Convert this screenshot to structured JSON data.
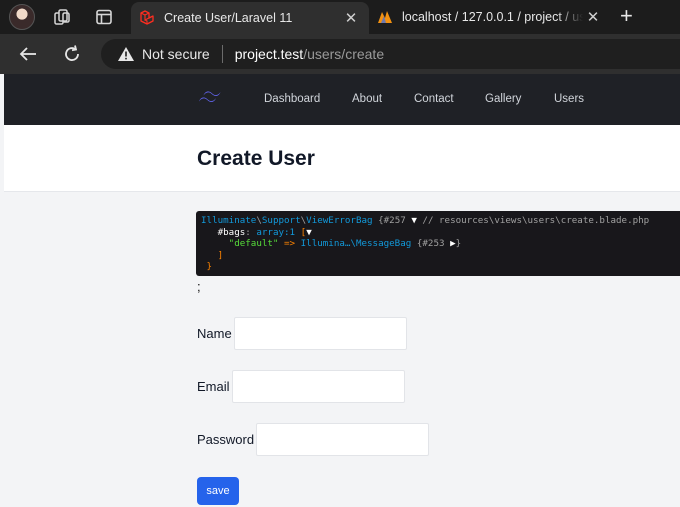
{
  "browser": {
    "tabs": [
      {
        "title": "Create User/Laravel 11",
        "active": true,
        "favicon": "laravel-icon"
      },
      {
        "title": "localhost / 127.0.0.1 / project / use",
        "active": false,
        "favicon": "phpmyadmin-icon"
      }
    ],
    "security_label": "Not secure",
    "url_host": "project.test",
    "url_path": "/users/create",
    "accent": "#2f2f2f"
  },
  "nav": {
    "logo": "tailwind-logo-icon",
    "links": [
      "Dashboard",
      "About",
      "Contact",
      "Gallery",
      "Users"
    ]
  },
  "header": {
    "title": "Create User"
  },
  "dump": {
    "line1_class_a": "Illuminate",
    "line1_class_b": "Support",
    "line1_class_c": "ViewErrorBag",
    "line1_id": "#257",
    "line1_comment": "// resources\\views\\users\\create.blade.php",
    "line2_key": "#bags",
    "line2_type": "array:1",
    "line3_key": "\"default\"",
    "line3_class": "Illumina…\\MessageBag",
    "line3_id": "#253",
    "semicolon": ";"
  },
  "form": {
    "fields": [
      {
        "label": "Name",
        "value": ""
      },
      {
        "label": "Email",
        "value": ""
      },
      {
        "label": "Password",
        "value": ""
      }
    ],
    "submit_label": "save",
    "submit_color": "#2563eb"
  }
}
